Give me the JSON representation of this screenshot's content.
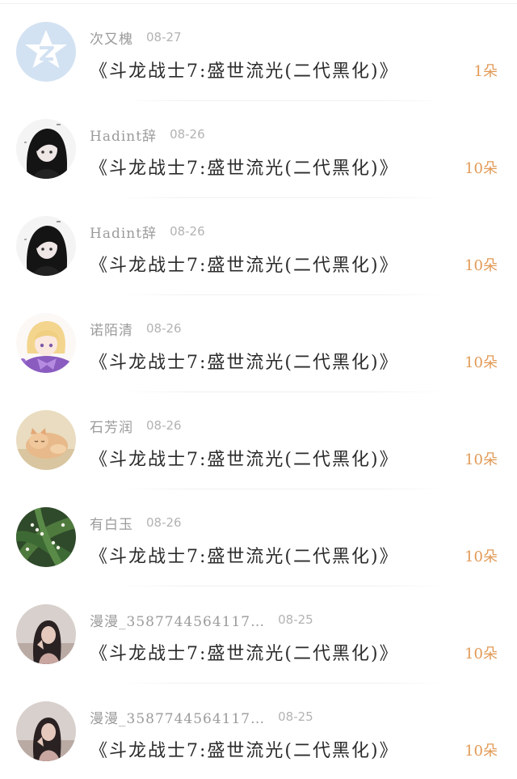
{
  "items": [
    {
      "name": "次又槐",
      "date": "08-27",
      "title": "《斗龙战士7:盛世流光(二代黑化)》",
      "count": "1朵",
      "avatar": "qzone-star-avatar"
    },
    {
      "name": "Hadint辞",
      "date": "08-26",
      "title": "《斗龙战士7:盛世流光(二代黑化)》",
      "count": "10朵",
      "avatar": "anime-girl-dark-avatar"
    },
    {
      "name": "Hadint辞",
      "date": "08-26",
      "title": "《斗龙战士7:盛世流光(二代黑化)》",
      "count": "10朵",
      "avatar": "anime-girl-dark-avatar"
    },
    {
      "name": "诺陌清",
      "date": "08-26",
      "title": "《斗龙战士7:盛世流光(二代黑化)》",
      "count": "10朵",
      "avatar": "anime-girl-blonde-avatar"
    },
    {
      "name": "石芳润",
      "date": "08-26",
      "title": "《斗龙战士7:盛世流光(二代黑化)》",
      "count": "10朵",
      "avatar": "kitten-avatar"
    },
    {
      "name": "有白玉",
      "date": "08-26",
      "title": "《斗龙战士7:盛世流光(二代黑化)》",
      "count": "10朵",
      "avatar": "lily-of-valley-avatar"
    },
    {
      "name": "漫漫_3587744564117…",
      "date": "08-25",
      "title": "《斗龙战士7:盛世流光(二代黑化)》",
      "count": "10朵",
      "avatar": "girl-photo-avatar"
    },
    {
      "name": "漫漫_3587744564117…",
      "date": "08-25",
      "title": "《斗龙战士7:盛世流光(二代黑化)》",
      "count": "10朵",
      "avatar": "girl-photo-avatar"
    }
  ],
  "colors": {
    "name": "#9b9b9b",
    "date": "#b3b3b3",
    "title": "#2b2b2b",
    "count": "#e29a57"
  }
}
